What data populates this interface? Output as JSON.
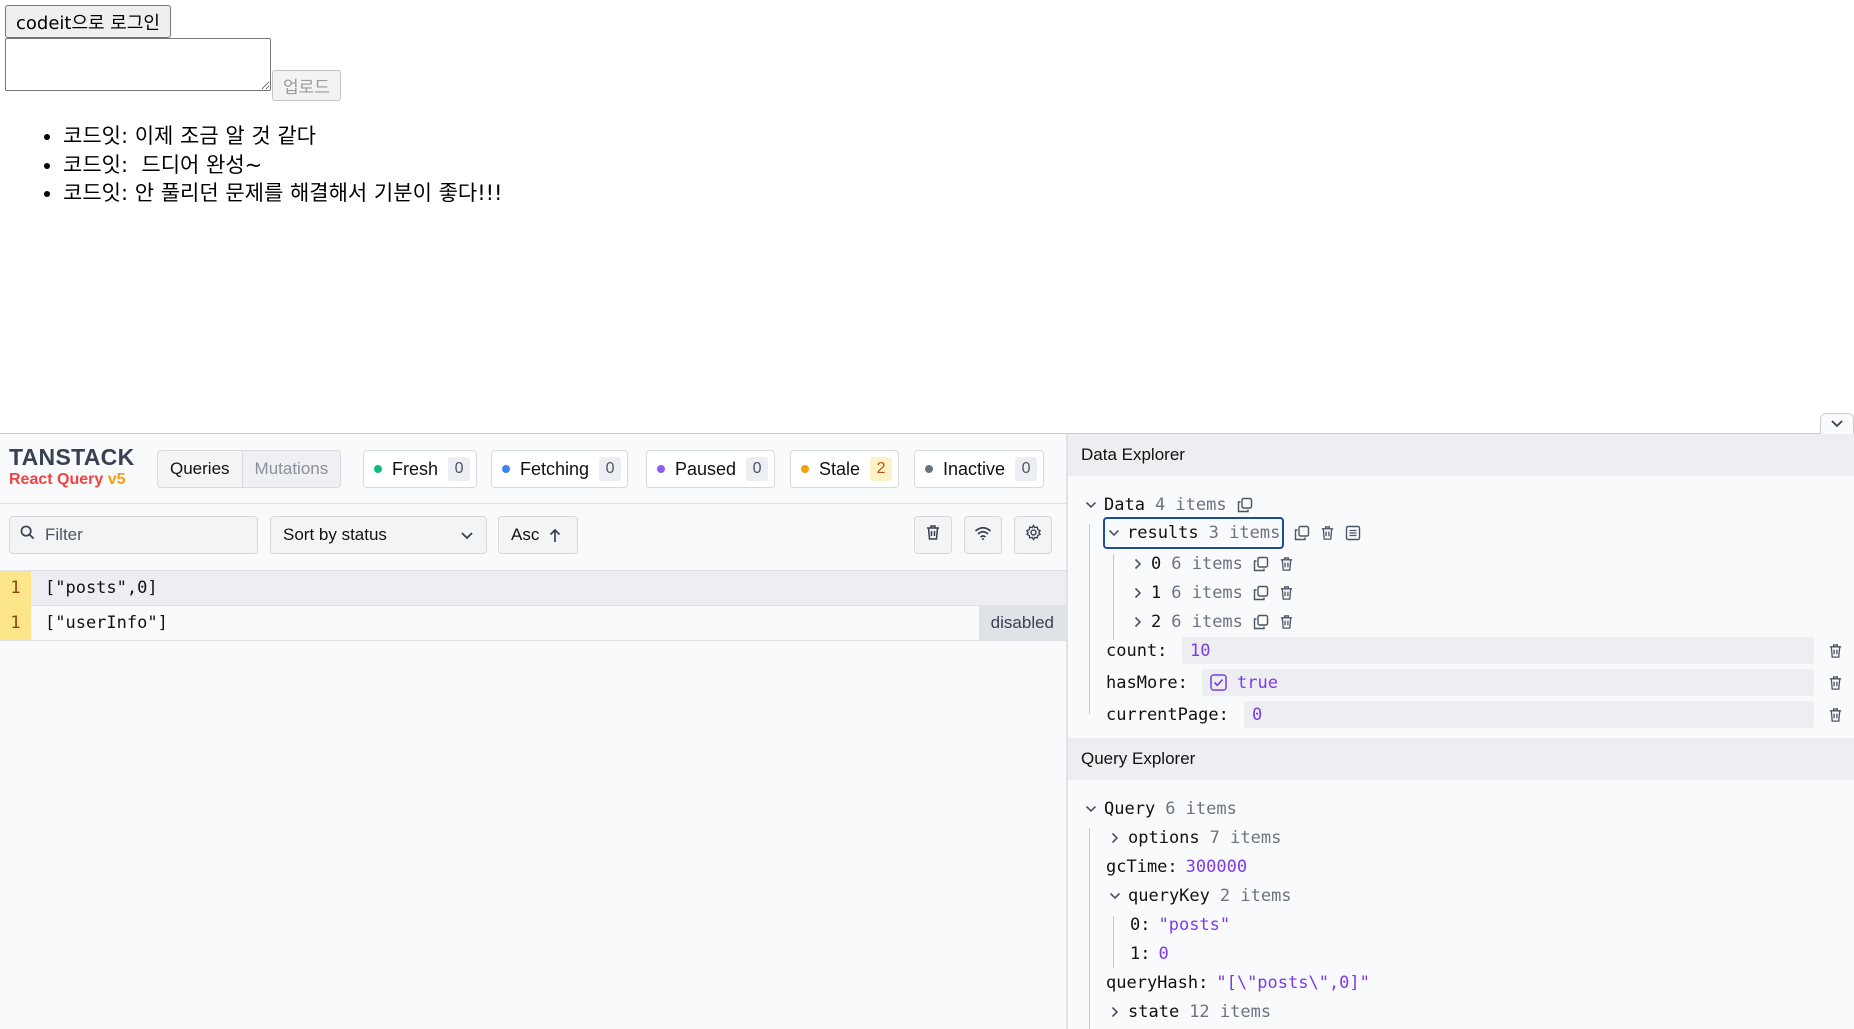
{
  "app": {
    "login_button": "codeit으로 로그인",
    "textarea_value": "",
    "upload_button": "업로드",
    "comments": [
      "코드잇: 이제 조금 알 것 같다",
      "코드잇:  드디어 완성~",
      "코드잇: 안 풀리던 문제를 해결해서 기분이 좋다!!!"
    ]
  },
  "devtools": {
    "logo_title": "TANSTACK",
    "logo_sub": "React Query",
    "logo_version": "v5",
    "tabs": {
      "queries": "Queries",
      "mutations": "Mutations"
    },
    "badges": [
      {
        "label": "Fresh",
        "count": "0",
        "color": "#10b981"
      },
      {
        "label": "Fetching",
        "count": "0",
        "color": "#3b82f6"
      },
      {
        "label": "Paused",
        "count": "0",
        "color": "#8b5cf6"
      },
      {
        "label": "Stale",
        "count": "2",
        "color": "#f59e0b"
      },
      {
        "label": "Inactive",
        "count": "0",
        "color": "#6b7280"
      }
    ],
    "filter_placeholder": "Filter",
    "sort_label": "Sort by status",
    "order_label": "Asc",
    "queries": [
      {
        "observers": "1",
        "key": "[\"posts\",0]",
        "tag": ""
      },
      {
        "observers": "1",
        "key": "[\"userInfo\"]",
        "tag": "disabled"
      }
    ],
    "data_explorer": {
      "title": "Data Explorer",
      "root_label": "Data",
      "root_count": "4 items",
      "results_label": "results",
      "results_count": "3 items",
      "result_items": [
        {
          "index": "0",
          "count": "6 items"
        },
        {
          "index": "1",
          "count": "6 items"
        },
        {
          "index": "2",
          "count": "6 items"
        }
      ],
      "count_key": "count:",
      "count_value": "10",
      "hasmore_key": "hasMore:",
      "hasmore_value": "true",
      "currentpage_key": "currentPage:",
      "currentpage_value": "0"
    },
    "query_explorer": {
      "title": "Query Explorer",
      "root_label": "Query",
      "root_count": "6 items",
      "options_label": "options",
      "options_count": "7 items",
      "gctime_key": "gcTime:",
      "gctime_value": "300000",
      "querykey_label": "queryKey",
      "querykey_count": "2 items",
      "qk0_key": "0:",
      "qk0_value": "\"posts\"",
      "qk1_key": "1:",
      "qk1_value": "0",
      "queryhash_key": "queryHash:",
      "queryhash_value": "\"[\\\"posts\\\",0]\"",
      "state_label": "state",
      "state_count": "12 items"
    }
  }
}
